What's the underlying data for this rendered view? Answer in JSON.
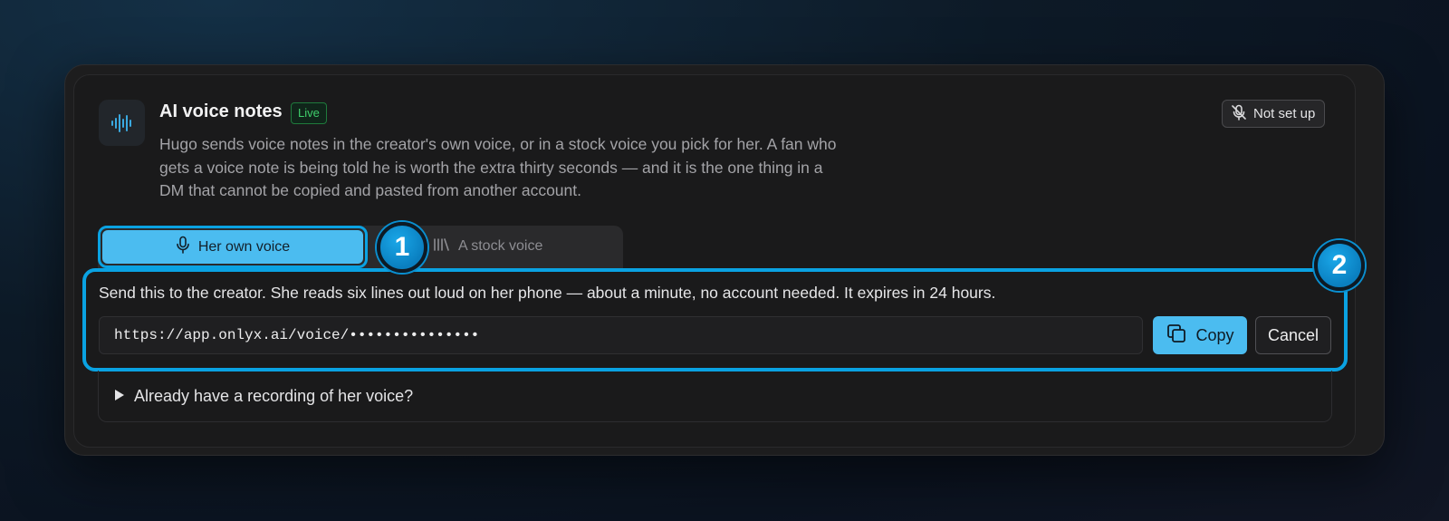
{
  "header": {
    "title": "AI voice notes",
    "badge": "Live",
    "description": "Hugo sends voice notes in the creator's own voice, or in a stock voice you pick for her. A fan who gets a voice note is being told he is worth the extra thirty seconds — and it is the one thing in a DM that cannot be copied and pasted from another account.",
    "status": "Not set up"
  },
  "tabs": [
    {
      "label": "Her own voice",
      "icon": "microphone-icon",
      "active": true
    },
    {
      "label": "A stock voice",
      "icon": "library-icon",
      "active": false
    }
  ],
  "markers": [
    "1",
    "2"
  ],
  "panel": {
    "instruction": "Send this to the creator. She reads six lines out loud on her phone — about a minute, no account needed. It expires in 24 hours.",
    "url": "https://app.onlyx.ai/voice/•••••••••••••••",
    "copy_label": "Copy",
    "cancel_label": "Cancel"
  },
  "recording": {
    "label": "Already have a recording of her voice?"
  },
  "colors": {
    "accent": "#4bbcf0",
    "highlight": "#0aa2e2",
    "live": "#3fce6b"
  }
}
